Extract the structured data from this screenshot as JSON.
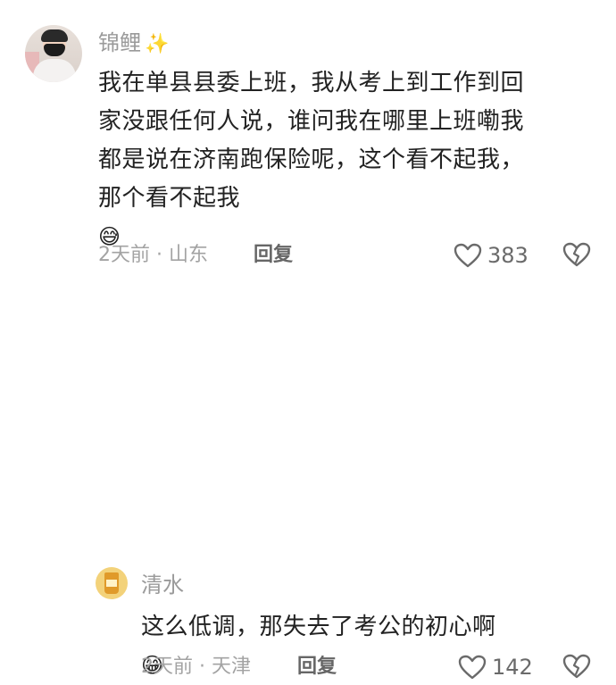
{
  "comments": [
    {
      "username": "锦鲤",
      "username_emoji": "✨",
      "text_lines": [
        "我在单县县委上班，我从考上到工作到回",
        "家没跟任何人说，谁问我在哪里上班嘞我",
        "都是说在济南跑保险呢，这个看不起我，",
        "那个看不起我"
      ],
      "text_emoji": "😅",
      "meta": "2天前 · 山东",
      "reply_label": "回复",
      "likes": "383"
    },
    {
      "username": "清水",
      "text_lines": [
        "这么低调，那失去了考公的初心啊"
      ],
      "text_emoji": "😁",
      "meta": "2天前 · 天津",
      "reply_label": "回复",
      "likes": "142"
    }
  ],
  "colors": {
    "text": "#222222",
    "secondary": "#9a9a9a",
    "icon": "#6a6a6a"
  }
}
